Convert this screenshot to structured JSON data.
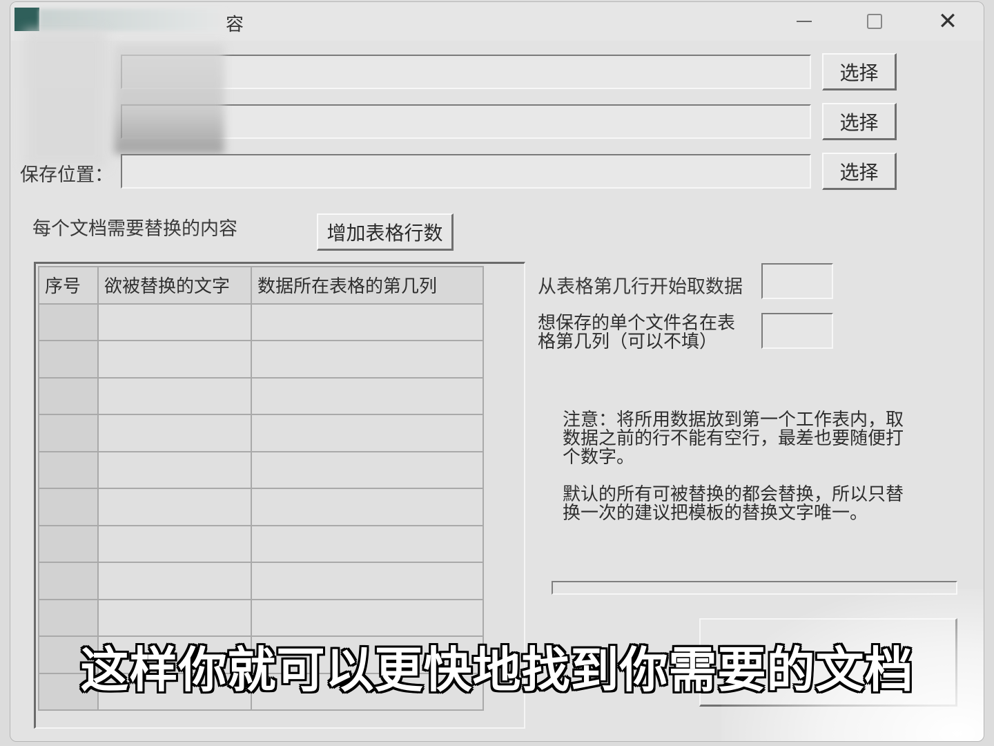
{
  "window": {
    "title": "容",
    "minimize_glyph": "—",
    "close_glyph": "✕"
  },
  "file_rows": [
    {
      "label": "",
      "value": "",
      "button": "选择"
    },
    {
      "label": "",
      "value": "",
      "button": "选择"
    },
    {
      "label": "保存位置：",
      "value": "",
      "button": "选择"
    }
  ],
  "replace_section": {
    "label": "每个文档需要替换的内容",
    "add_rows_button": "增加表格行数"
  },
  "grid": {
    "columns": [
      "序号",
      "欲被替换的文字",
      "数据所在表格的第几列"
    ],
    "row_count": 11
  },
  "options": {
    "start_row_label": "从表格第几行开始取数据",
    "start_row_value": "",
    "filename_col_label_line1": "想保存的单个文件名在表",
    "filename_col_label_line2": "格第几列（可以不填）",
    "filename_col_value": ""
  },
  "notes": {
    "note1_line1": "注意：将所用数据放到第一个工作表内，取",
    "note1_line2": "数据之前的行不能有空行，最差也要随便打",
    "note1_line3": "个数字。",
    "note2_line1": "默认的所有可被替换的都会替换，所以只替",
    "note2_line2": "换一次的建议把模板的替换文字唯一。"
  },
  "progress": {
    "value": 0
  },
  "subtitle": "这样你就可以更快地找到你需要的文档",
  "colors": {
    "app_icon": "#2f5f5a",
    "window_bg": "#e3e3e3",
    "grid_lines": "#a9a9a9"
  }
}
